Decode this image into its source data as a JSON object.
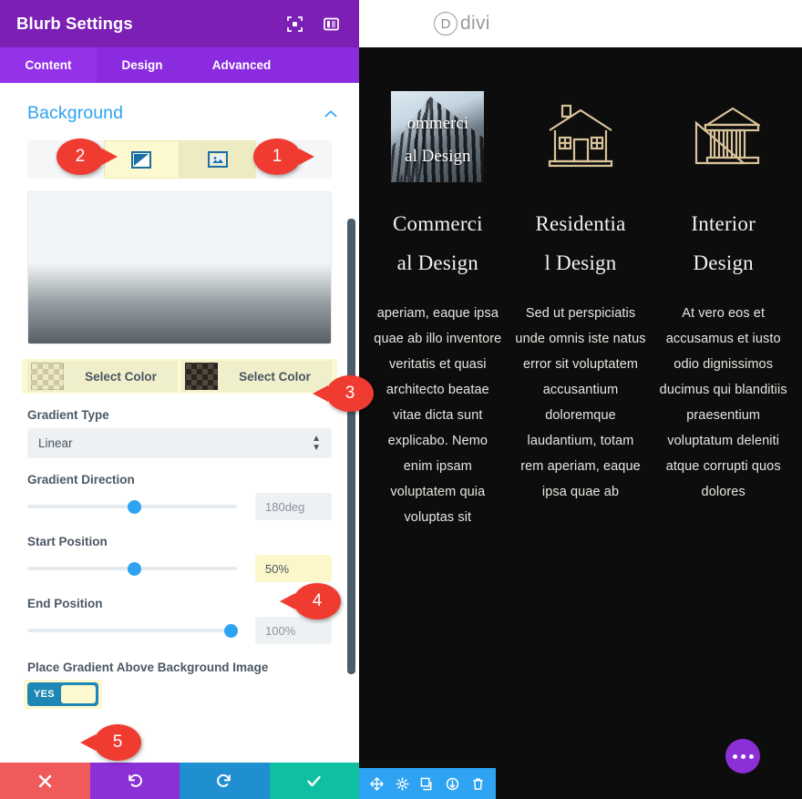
{
  "panel": {
    "title": "Blurb Settings",
    "header_icons": [
      {
        "name": "focus-mode-icon"
      },
      {
        "name": "panel-layout-icon"
      }
    ],
    "tabs": [
      {
        "label": "Content",
        "active": true
      },
      {
        "label": "Design",
        "active": false
      },
      {
        "label": "Advanced",
        "active": false
      }
    ],
    "section": {
      "title": "Background",
      "collapse_icon": "chevron-up-icon"
    },
    "bg_types": [
      {
        "name": "background-gradient-tab",
        "icon": "gradient-icon"
      },
      {
        "name": "background-image-tab",
        "icon": "image-icon"
      }
    ],
    "colors": [
      {
        "label": "Select Color",
        "swatch": "transparent-checker"
      },
      {
        "label": "Select Color",
        "swatch": "dark-checker"
      }
    ],
    "gradient_type": {
      "label": "Gradient Type",
      "value": "Linear"
    },
    "gradient_direction": {
      "label": "Gradient Direction",
      "value": "180deg",
      "knob_percent": 50
    },
    "start_position": {
      "label": "Start Position",
      "value": "50%",
      "knob_percent": 50
    },
    "end_position": {
      "label": "End Position",
      "value": "100%",
      "knob_percent": 96
    },
    "place_gradient": {
      "label": "Place Gradient Above Background Image",
      "toggle_text": "YES"
    },
    "footer": [
      {
        "name": "cancel-button",
        "icon": "close-icon"
      },
      {
        "name": "undo-button",
        "icon": "undo-icon"
      },
      {
        "name": "redo-button",
        "icon": "redo-icon"
      },
      {
        "name": "save-button",
        "icon": "check-icon"
      }
    ]
  },
  "preview": {
    "brand": {
      "letter": "D",
      "word": "divi"
    },
    "blurbs": [
      {
        "icon": "building-photo-icon",
        "overlay_text_line1": "ommerci",
        "overlay_text_line2": "al Design",
        "title_line1": "Commerci",
        "title_line2": "al Design",
        "body": "aperiam, eaque ipsa quae ab illo inventore veritatis et quasi architecto beatae vitae dicta sunt explicabo. Nemo enim ipsam voluptatem quia voluptas sit"
      },
      {
        "icon": "house-icon",
        "title_line1": "Residentia",
        "title_line2": "l Design",
        "body": "Sed ut perspiciatis unde omnis iste natus error sit voluptatem accusantium doloremque laudantium, totam rem aperiam, eaque ipsa quae ab"
      },
      {
        "icon": "classical-building-ruler-icon",
        "title_line1": "Interior",
        "title_line2": "Design",
        "body": "At vero eos et accusamus et iusto odio dignissimos ducimus qui blanditiis praesentium voluptatum deleniti atque corrupti quos dolores"
      }
    ],
    "fab": {
      "name": "page-settings-fab",
      "icon": "ellipsis-icon"
    },
    "module_toolbar": [
      {
        "name": "move-module-icon"
      },
      {
        "name": "module-settings-gear-icon"
      },
      {
        "name": "duplicate-module-icon"
      },
      {
        "name": "save-to-library-icon"
      },
      {
        "name": "delete-module-icon"
      }
    ],
    "pointer_arrow": "red-arrow-icon"
  },
  "callouts": [
    {
      "number": "1",
      "side": "right"
    },
    {
      "number": "2",
      "side": "right"
    },
    {
      "number": "3",
      "side": "left"
    },
    {
      "number": "4",
      "side": "left"
    },
    {
      "number": "5",
      "side": "left"
    }
  ],
  "colors": {
    "panel_header": "#7b1fb5",
    "tab_bar": "#8a2be0",
    "accent_blue": "#2ea3f2",
    "highlight_yellow": "#fcf8cf",
    "callout_red": "#ef3b30",
    "toggle_teal": "#1e87b5",
    "preview_bg": "#0d0d0d",
    "blurb_icon_gold": "#d9c39a"
  }
}
